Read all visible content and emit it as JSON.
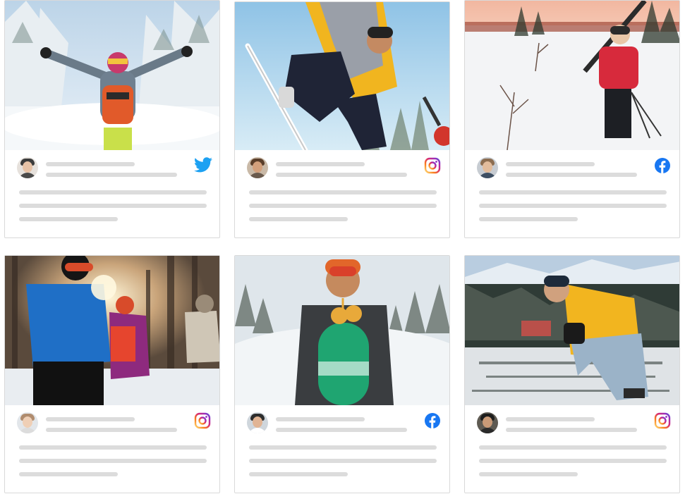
{
  "feed": {
    "cards": [
      {
        "network": "twitter",
        "network_icon": "twitter-icon",
        "scene": "backpacker-snow-forest",
        "brand": "#1da1f2"
      },
      {
        "network": "instagram",
        "network_icon": "instagram-icon",
        "scene": "snowboarder-jump",
        "brand": "#e1306c"
      },
      {
        "network": "facebook",
        "network_icon": "facebook-icon",
        "scene": "skier-sunset",
        "brand": "#1877f2"
      },
      {
        "network": "instagram",
        "network_icon": "instagram-icon",
        "scene": "snow-fight-forest",
        "brand": "#e1306c"
      },
      {
        "network": "facebook",
        "network_icon": "facebook-icon",
        "scene": "snowboarder-holding-board",
        "brand": "#1877f2"
      },
      {
        "network": "instagram",
        "network_icon": "instagram-icon",
        "scene": "yellow-jacket-mountain",
        "brand": "#e1306c"
      }
    ]
  },
  "colors": {
    "card_border": "#d9d9d9",
    "skeleton": "#dcdcdc",
    "twitter": "#1da1f2",
    "facebook": "#1877f2",
    "instagram_gradient": [
      "#feda75",
      "#fa7e1e",
      "#d62976",
      "#962fbf",
      "#4f5bd5"
    ]
  }
}
